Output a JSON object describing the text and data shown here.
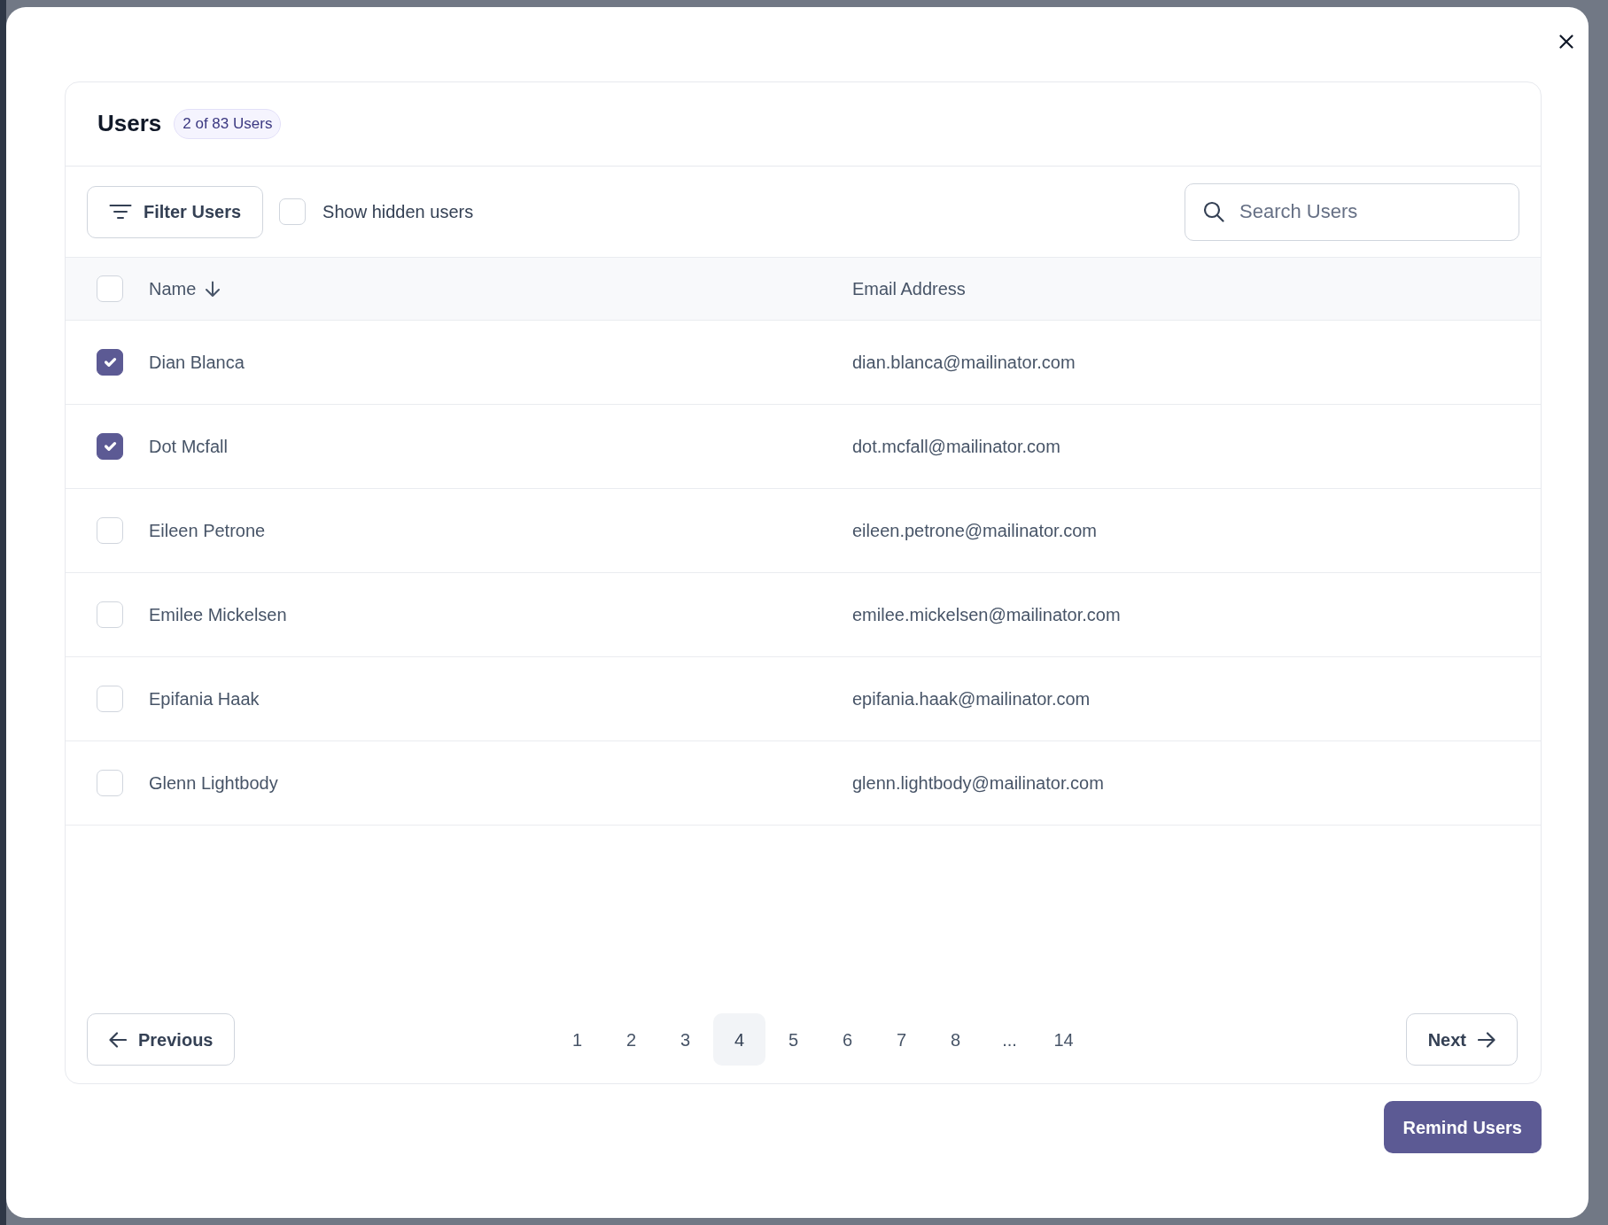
{
  "users_card": {
    "title": "Users",
    "count_badge": "2 of 83 Users"
  },
  "toolbar": {
    "filter_button": "Filter Users",
    "show_hidden": {
      "label": "Show hidden users",
      "checked": false
    },
    "search": {
      "placeholder": "Search Users"
    }
  },
  "table": {
    "select_all": {
      "checked": false
    },
    "columns": [
      {
        "label": "Name",
        "sorted": true,
        "ascending": true
      },
      {
        "label": "Email Address",
        "sorted": false
      }
    ],
    "rows": [
      {
        "name": "Dian Blanca",
        "email": "dian.blanca@mailinator.com",
        "selected": true
      },
      {
        "name": "Dot Mcfall",
        "email": "dot.mcfall@mailinator.com",
        "selected": true
      },
      {
        "name": "Eileen Petrone",
        "email": "eileen.petrone@mailinator.com",
        "selected": false
      },
      {
        "name": "Emilee Mickelsen",
        "email": "emilee.mickelsen@mailinator.com",
        "selected": false
      },
      {
        "name": "Epifania Haak",
        "email": "epifania.haak@mailinator.com",
        "selected": false
      },
      {
        "name": "Glenn Lightbody",
        "email": "glenn.lightbody@mailinator.com",
        "selected": false
      }
    ]
  },
  "pagination": {
    "previous": "Previous",
    "pages": [
      {
        "kind": "page",
        "label": "1",
        "selected": false
      },
      {
        "kind": "page",
        "label": "2",
        "selected": false
      },
      {
        "kind": "page",
        "label": "3",
        "selected": false
      },
      {
        "kind": "page",
        "label": "4",
        "selected": true
      },
      {
        "kind": "page",
        "label": "5",
        "selected": false
      },
      {
        "kind": "page",
        "label": "6",
        "selected": false
      },
      {
        "kind": "page",
        "label": "7",
        "selected": false
      },
      {
        "kind": "page",
        "label": "8",
        "selected": false
      },
      {
        "kind": "gap",
        "label": "..."
      },
      {
        "kind": "page",
        "label": "14",
        "selected": false
      }
    ],
    "next": "Next"
  },
  "footer": {
    "remind_button": "Remind Users"
  }
}
